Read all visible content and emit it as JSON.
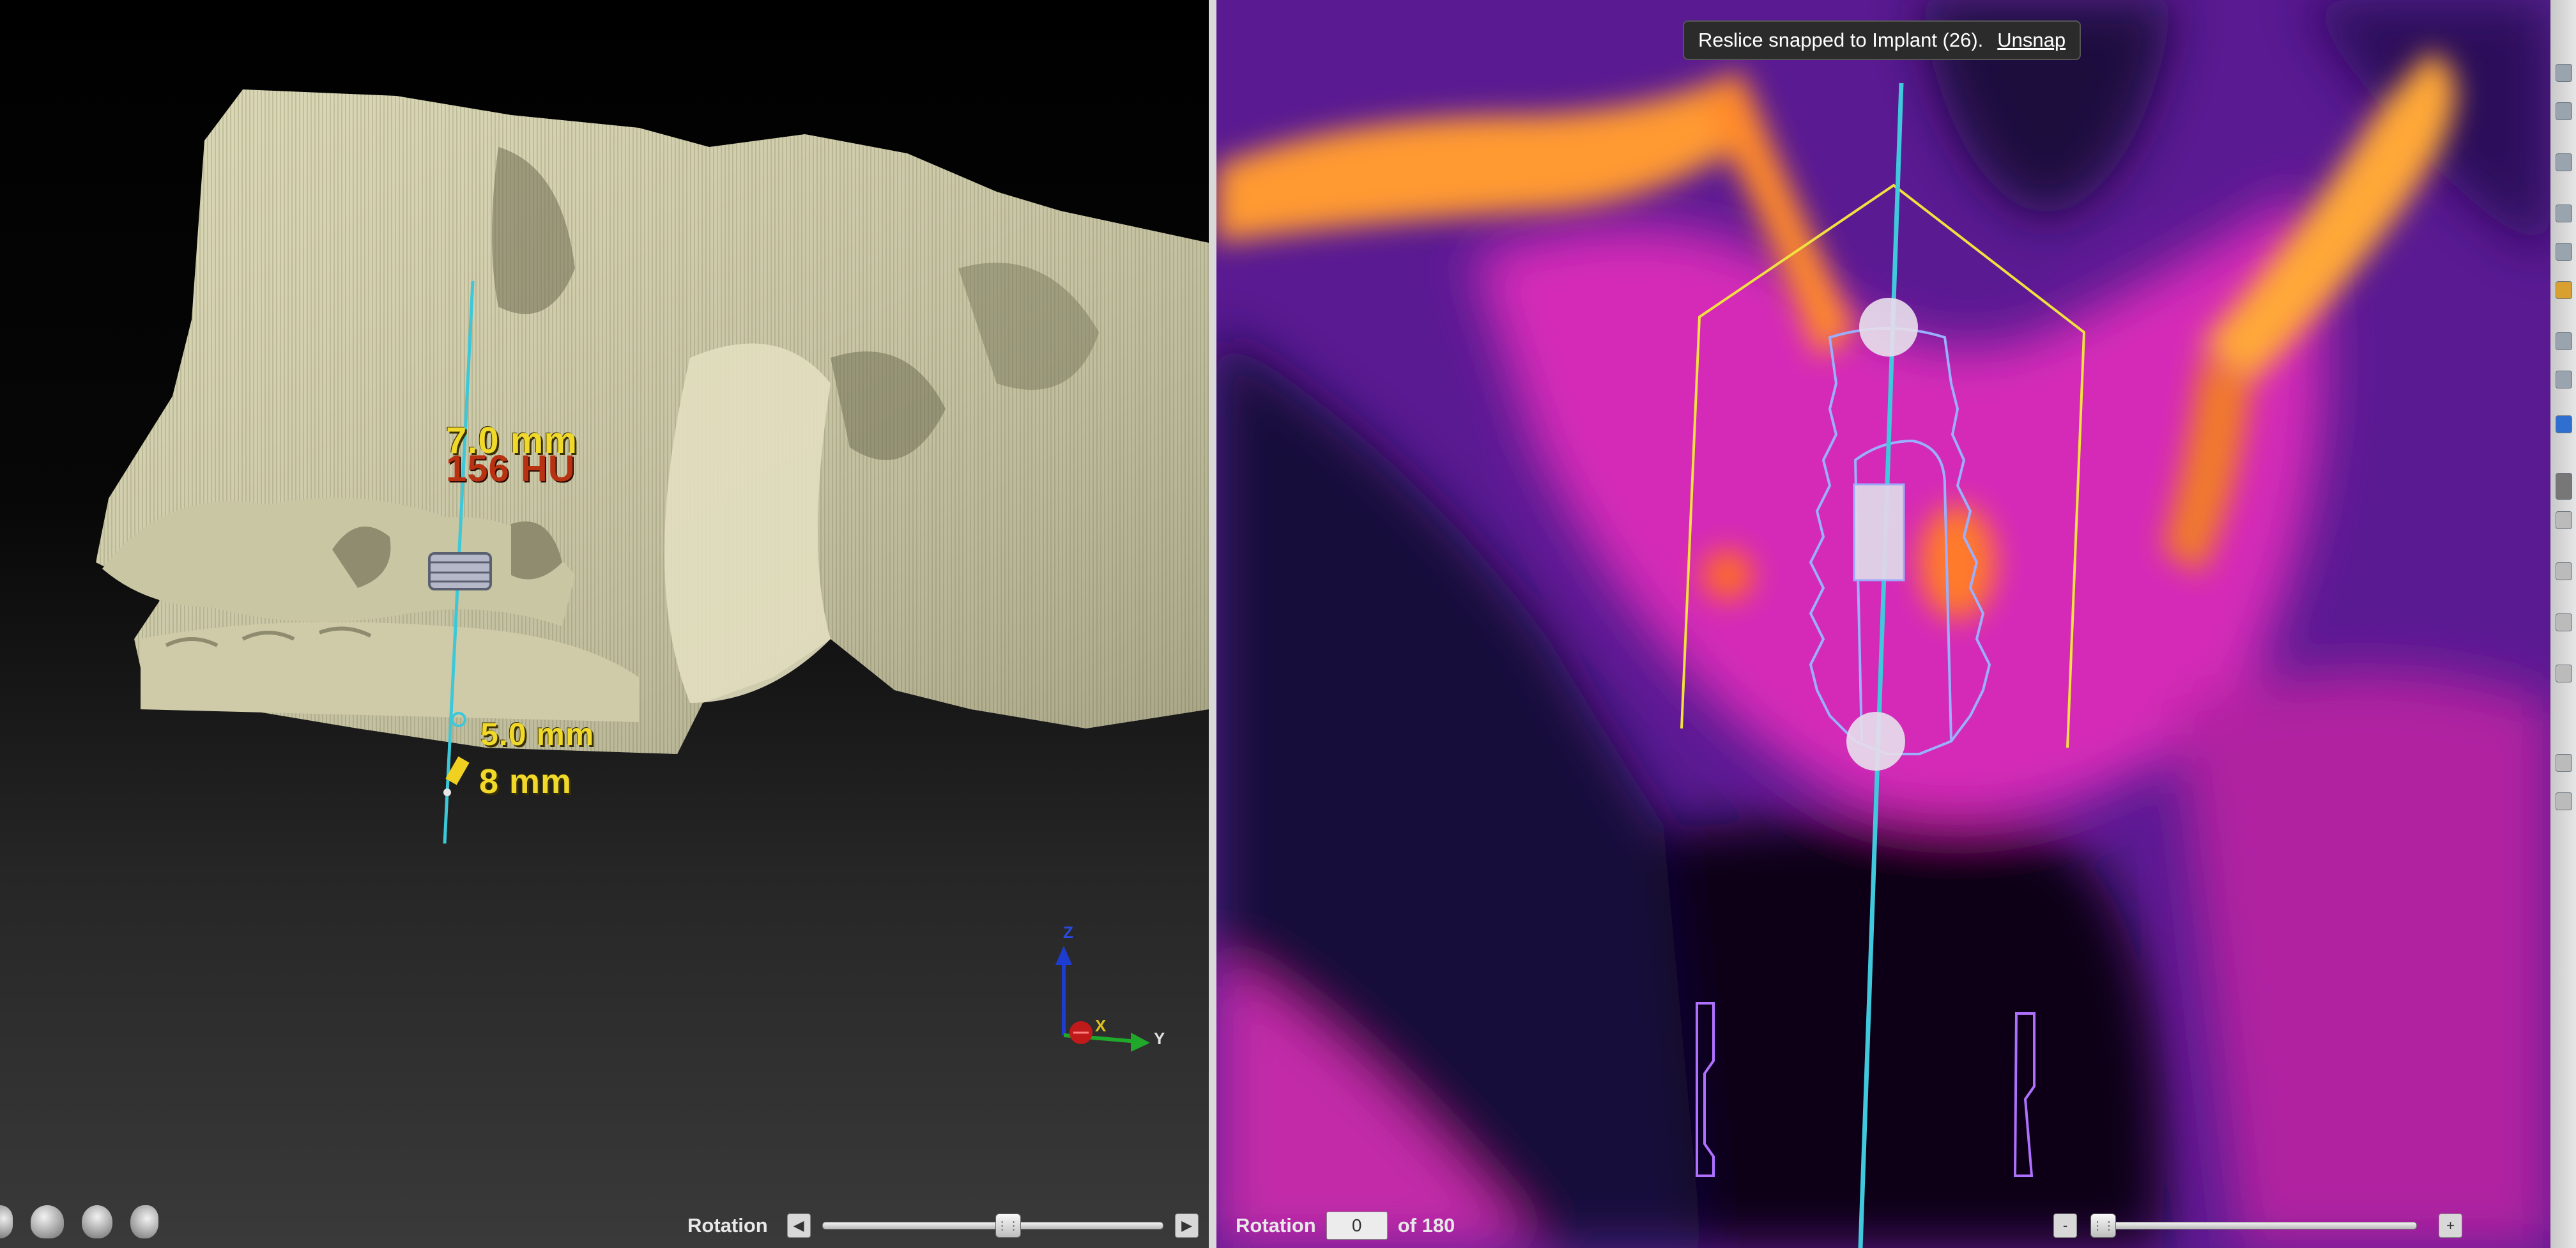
{
  "view3d": {
    "measure_top_mm": "7.0 mm",
    "measure_hu": "156 HU",
    "measure_width_mm": "5.0 mm",
    "measure_length_mm": "8 mm",
    "axes": {
      "z": "Z",
      "x": "X",
      "y": "Y"
    },
    "rotation_label": "Rotation",
    "icons": [
      "skull-icon",
      "skull-icon",
      "skull-icon",
      "skull-profile-icon"
    ]
  },
  "reslice": {
    "snap_message": "Reslice snapped to Implant (26).",
    "unsnap_label": "Unsnap",
    "rotation_label": "Rotation",
    "rotation_value": "0",
    "rotation_of": "of 180",
    "minus_label": "-",
    "plus_label": "+"
  },
  "colors": {
    "bone_3d": "#d9d6b6",
    "implant_axis": "#3cc8d8",
    "implant_outline": "#9ab0ff",
    "safety_zone": "#f0e040",
    "heat_high": "#ffb030",
    "heat_mid": "#e02fbf",
    "heat_low": "#3a1570"
  }
}
